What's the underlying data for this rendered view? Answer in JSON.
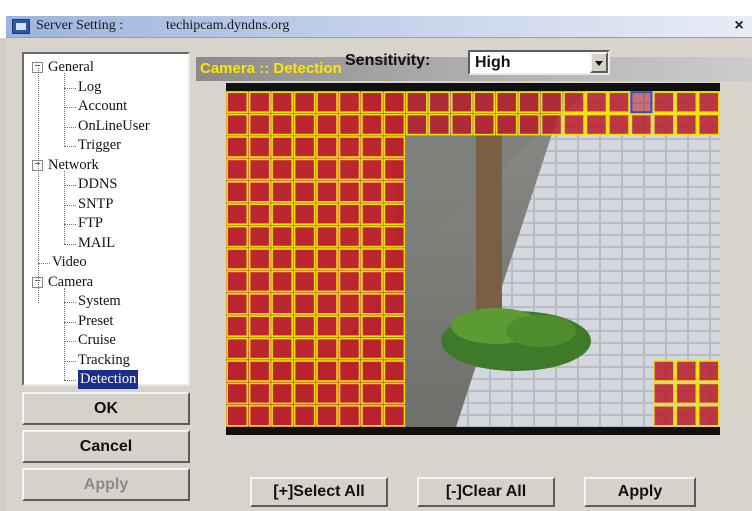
{
  "window": {
    "title_label": "Server Setting :",
    "host": "techipcam.dyndns.org",
    "close_label": "×"
  },
  "tree": {
    "groups": [
      {
        "label": "General",
        "toggle": "−",
        "children": [
          "Log",
          "Account",
          "OnLineUser",
          "Trigger"
        ]
      },
      {
        "label": "Network",
        "toggle": "−",
        "children": [
          "DDNS",
          "SNTP",
          "FTP",
          "MAIL"
        ]
      },
      {
        "label": "Video",
        "toggle": "",
        "children": []
      },
      {
        "label": "Camera",
        "toggle": "−",
        "children": [
          "System",
          "Preset",
          "Cruise",
          "Tracking",
          "Detection"
        ]
      }
    ],
    "selected": "Detection"
  },
  "buttons": {
    "ok": "OK",
    "cancel": "Cancel",
    "apply_disabled": "Apply",
    "select_all": "[+]Select All",
    "clear_all": "[-]Clear All",
    "apply": "Apply"
  },
  "header": {
    "title": "Camera :: Detection"
  },
  "sensitivity": {
    "label": "Sensitivity:",
    "value": "High"
  },
  "detection_grid": {
    "columns": 22,
    "rows": 15,
    "active_regions": [
      {
        "rows": [
          0,
          1
        ],
        "cols": [
          0,
          21
        ]
      },
      {
        "rows": [
          2,
          14
        ],
        "cols": [
          0,
          7
        ]
      },
      {
        "rows": [
          12,
          14
        ],
        "cols": [
          19,
          21
        ]
      }
    ],
    "focused_cell": {
      "row": 0,
      "col": 18
    },
    "colors": {
      "active_fill": "#b81c2c",
      "grid_line": "#f0e000",
      "focused_outline": "#3a4aa8"
    }
  },
  "colors": {
    "header_text": "#ffe400",
    "selection": "#1c2d8a"
  }
}
